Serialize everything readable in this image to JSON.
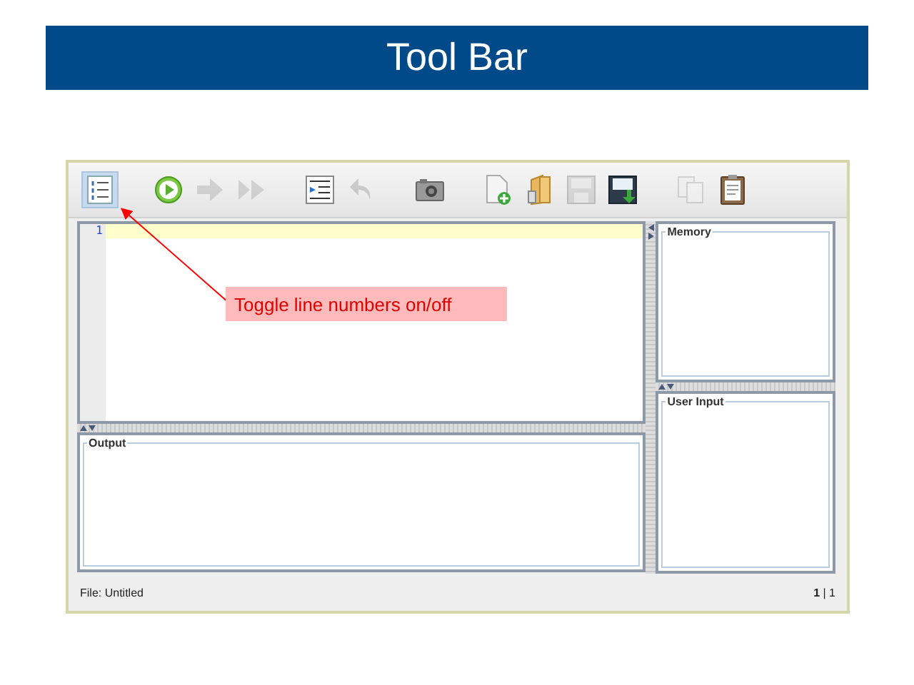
{
  "slide": {
    "title": "Tool Bar"
  },
  "toolbar": {
    "groups": [
      [
        {
          "kind": "line-numbers",
          "disabled": false,
          "selected": true
        }
      ],
      [
        {
          "kind": "run",
          "disabled": false,
          "selected": false
        },
        {
          "kind": "step",
          "disabled": true,
          "selected": false
        },
        {
          "kind": "fast-forward",
          "disabled": true,
          "selected": false
        }
      ],
      [
        {
          "kind": "indent",
          "disabled": false,
          "selected": false
        },
        {
          "kind": "undo",
          "disabled": true,
          "selected": false
        }
      ],
      [
        {
          "kind": "camera",
          "disabled": false,
          "selected": false
        }
      ],
      [
        {
          "kind": "new-file",
          "disabled": false,
          "selected": false
        },
        {
          "kind": "open",
          "disabled": false,
          "selected": false
        },
        {
          "kind": "save",
          "disabled": true,
          "selected": false
        },
        {
          "kind": "save-as",
          "disabled": false,
          "selected": false
        }
      ],
      [
        {
          "kind": "copy",
          "disabled": true,
          "selected": false
        },
        {
          "kind": "paste",
          "disabled": false,
          "selected": false
        }
      ]
    ]
  },
  "editor": {
    "line_numbers": [
      "1"
    ]
  },
  "panels": {
    "output": "Output",
    "memory": "Memory",
    "user_input": "User Input"
  },
  "status_bar": {
    "file": "File: Untitled",
    "position": "**1** | 1"
  },
  "callout": {
    "text": "Toggle line numbers on/off"
  }
}
